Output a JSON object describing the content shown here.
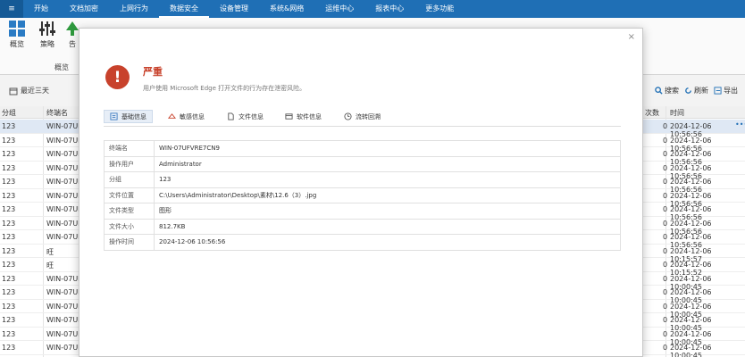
{
  "menubar": {
    "app_button_glyph": "≡",
    "items": [
      "开始",
      "文档加密",
      "上网行为",
      "数据安全",
      "设备管理",
      "系统&网络",
      "运维中心",
      "报表中心",
      "更多功能"
    ],
    "active_index": 3
  },
  "ribbon": {
    "buttons": [
      {
        "label": "概览",
        "icon": "grid-icon"
      },
      {
        "label": "策略",
        "icon": "sliders-icon"
      },
      {
        "label": "告",
        "icon": "alert-icon"
      }
    ],
    "group_label": "概览"
  },
  "subbar": {
    "recent_label": "最近三天",
    "actions": [
      {
        "label": "搜索",
        "icon": "search-icon"
      },
      {
        "label": "刷新",
        "icon": "refresh-icon"
      },
      {
        "label": "导出",
        "icon": "export-icon"
      }
    ]
  },
  "bg_table": {
    "headers": {
      "group": "分组",
      "terminal": "终端名",
      "count": "次数",
      "time": "时间"
    },
    "more_glyph": "•••",
    "rows": [
      {
        "group": "123",
        "terminal": "WIN-07UF",
        "count": "0",
        "time": "2024-12-06 10:56:56"
      },
      {
        "group": "123",
        "terminal": "WIN-07UF",
        "count": "0",
        "time": "2024-12-06 10:56:56"
      },
      {
        "group": "123",
        "terminal": "WIN-07UF",
        "count": "0",
        "time": "2024-12-06 10:56:56"
      },
      {
        "group": "123",
        "terminal": "WIN-07UF",
        "count": "0",
        "time": "2024-12-06 10:56:56"
      },
      {
        "group": "123",
        "terminal": "WIN-07UF",
        "count": "0",
        "time": "2024-12-06 10:56:56"
      },
      {
        "group": "123",
        "terminal": "WIN-07UF",
        "count": "0",
        "time": "2024-12-06 10:56:56"
      },
      {
        "group": "123",
        "terminal": "WIN-07UF",
        "count": "0",
        "time": "2024-12-06 10:56:56"
      },
      {
        "group": "123",
        "terminal": "WIN-07UF",
        "count": "0",
        "time": "2024-12-06 10:56:56"
      },
      {
        "group": "123",
        "terminal": "WIN-07UF",
        "count": "0",
        "time": "2024-12-06 10:56:56"
      },
      {
        "group": "123",
        "terminal": "旺",
        "count": "0",
        "time": "2024-12-06 10:15:57"
      },
      {
        "group": "123",
        "terminal": "旺",
        "count": "0",
        "time": "2024-12-06 10:15:52"
      },
      {
        "group": "123",
        "terminal": "WIN-07UF",
        "count": "0",
        "time": "2024-12-06 10:00:45"
      },
      {
        "group": "123",
        "terminal": "WIN-07UF",
        "count": "0",
        "time": "2024-12-06 10:00:45"
      },
      {
        "group": "123",
        "terminal": "WIN-07UF",
        "count": "0",
        "time": "2024-12-06 10:00:45"
      },
      {
        "group": "123",
        "terminal": "WIN-07UF",
        "count": "0",
        "time": "2024-12-06 10:00:45"
      },
      {
        "group": "123",
        "terminal": "WIN-07UF",
        "count": "0",
        "time": "2024-12-06 10:00:45"
      },
      {
        "group": "123",
        "terminal": "WIN-07UF",
        "count": "0",
        "time": "2024-12-06 10:00:45"
      }
    ]
  },
  "modal": {
    "close_glyph": "×",
    "severity_glyph": "!",
    "severity_color": "#c8422c",
    "severity": "严重",
    "description": "用户使用 Microsoft Edge 打开文件的行为存在泄密风险。",
    "tabs": [
      {
        "label": "基础信息",
        "icon": "info-icon"
      },
      {
        "label": "敏感信息",
        "icon": "sensitive-icon"
      },
      {
        "label": "文件信息",
        "icon": "file-icon"
      },
      {
        "label": "软件信息",
        "icon": "software-icon"
      },
      {
        "label": "流转回溯",
        "icon": "history-icon"
      }
    ],
    "active_tab": 0,
    "fields": [
      {
        "key": "终端名",
        "value": "WIN-07UFVRE7CN9"
      },
      {
        "key": "操作用户",
        "value": "Administrator"
      },
      {
        "key": "分组",
        "value": "123"
      },
      {
        "key": "文件位置",
        "value": "C:\\Users\\Administrator\\Desktop\\素材\\12.6（3）.jpg"
      },
      {
        "key": "文件类型",
        "value": "图形"
      },
      {
        "key": "文件大小",
        "value": "812.7KB"
      },
      {
        "key": "操作时间",
        "value": "2024-12-06 10:56:56"
      }
    ]
  }
}
